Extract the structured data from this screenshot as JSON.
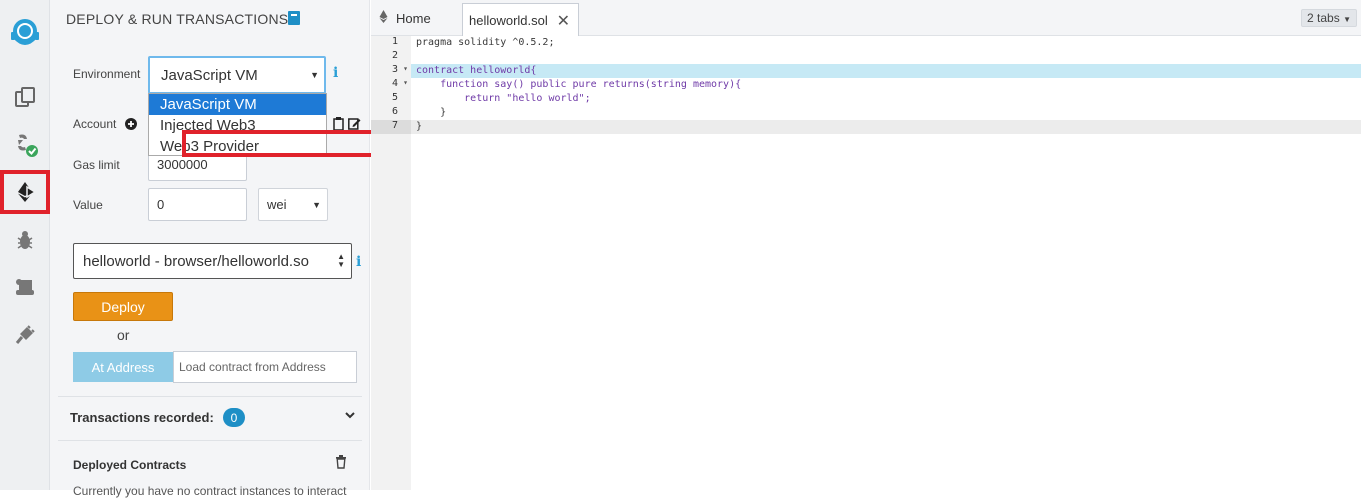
{
  "panel": {
    "title": "DEPLOY & RUN TRANSACTIONS",
    "environment_label": "Environment",
    "environment_value": "JavaScript VM",
    "environment_options": [
      "JavaScript VM",
      "Injected Web3",
      "Web3 Provider"
    ],
    "account_label": "Account",
    "gas_limit_label": "Gas limit",
    "gas_limit_value": "3000000",
    "value_label": "Value",
    "value_amount": "0",
    "value_unit": "wei",
    "contract_value": "helloworld - browser/helloworld.so",
    "deploy_label": "Deploy",
    "or_label": "or",
    "at_address_label": "At Address",
    "at_address_placeholder": "Load contract from Address",
    "transactions_recorded_label": "Transactions recorded:",
    "transactions_recorded_count": "0",
    "deployed_contracts_label": "Deployed Contracts",
    "deployed_contracts_note": "Currently you have no contract instances to interact"
  },
  "tabs": {
    "home_label": "Home",
    "active_label": "helloworld.sol",
    "count_label": "2 tabs"
  },
  "editor": {
    "line_numbers": [
      "1",
      "2",
      "3",
      "4",
      "5",
      "6",
      "7"
    ],
    "lines": [
      "pragma solidity ^0.5.2;",
      "",
      "contract helloworld{",
      "    function say() public pure returns(string memory){",
      "        return \"hello world\";",
      "    }",
      "}"
    ]
  },
  "colors": {
    "highlight_red": "#e0222b",
    "deploy_orange": "#e99216",
    "at_address_blue": "#8ecbe6",
    "selection_blue": "#1e7ad6",
    "active_line": "#c6e9f5"
  }
}
